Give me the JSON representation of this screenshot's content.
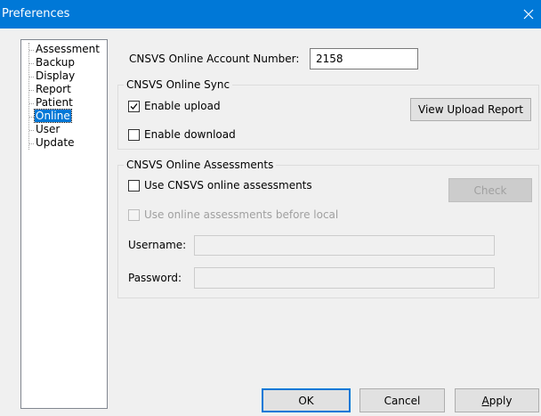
{
  "window": {
    "title": "Preferences"
  },
  "tree": {
    "items": [
      {
        "label": "Assessment",
        "selected": false
      },
      {
        "label": "Backup",
        "selected": false
      },
      {
        "label": "Display",
        "selected": false
      },
      {
        "label": "Report",
        "selected": false
      },
      {
        "label": "Patient",
        "selected": false
      },
      {
        "label": "Online",
        "selected": true
      },
      {
        "label": "User",
        "selected": false
      },
      {
        "label": "Update",
        "selected": false
      }
    ]
  },
  "account": {
    "label": "CNSVS Online Account Number:",
    "value": "2158"
  },
  "sync": {
    "title": "CNSVS Online Sync",
    "enable_upload": {
      "label": "Enable upload",
      "checked": true
    },
    "enable_download": {
      "label": "Enable download",
      "checked": false
    },
    "view_report_label": "View Upload Report"
  },
  "assessments": {
    "title": "CNSVS Online Assessments",
    "use_online": {
      "label": "Use CNSVS online assessments",
      "checked": false
    },
    "check_label": "Check",
    "use_before_local": {
      "label": "Use online assessments before local",
      "checked": false
    },
    "username": {
      "label": "Username:",
      "value": ""
    },
    "password": {
      "label": "Password:",
      "value": ""
    }
  },
  "footer": {
    "ok_label": "OK",
    "cancel_label": "Cancel",
    "apply_label": "Apply",
    "apply_mnemonic": "A",
    "apply_rest": "pply"
  },
  "colors": {
    "titlebar": "#0078d7",
    "selection": "#0078d7"
  },
  "icons": {
    "close": "close-icon",
    "check": "checkmark-icon"
  }
}
